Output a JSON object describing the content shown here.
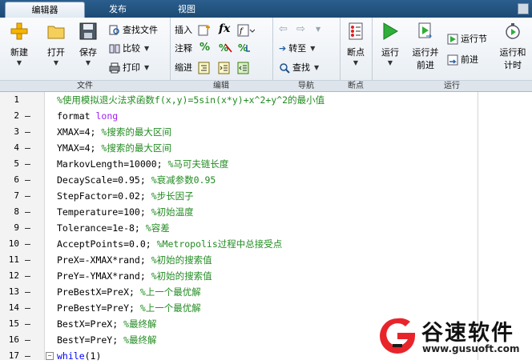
{
  "tabs": [
    {
      "label": "编辑器"
    },
    {
      "label": "发布"
    },
    {
      "label": "视图"
    }
  ],
  "toolstrip": {
    "file": {
      "group_label": "文件",
      "new_label": "新建",
      "open_label": "打开",
      "save_label": "保存",
      "find_files_label": "查找文件",
      "compare_label": "比较",
      "print_label": "打印"
    },
    "edit": {
      "group_label": "编辑",
      "insert_label": "插入",
      "comment_label": "注释",
      "indent_label": "缩进"
    },
    "navigate": {
      "group_label": "导航",
      "goto_label": "转至",
      "find_label": "查找"
    },
    "breakpoints": {
      "group_label": "断点",
      "breakpoints_label": "断点"
    },
    "run": {
      "group_label": "运行",
      "run_label": "运行",
      "run_advance_label_1": "运行并",
      "run_advance_label_2": "前进",
      "run_section_label": "运行节",
      "advance_label": "前进",
      "run_time_label_1": "运行和",
      "run_time_label_2": "计时"
    }
  },
  "editor": {
    "lines": [
      {
        "n": "1",
        "marker": "",
        "kw": "",
        "text": "",
        "comment": "%使用模拟退火法求函数f(x,y)=5sin(x*y)+x^2+y^2的最小值",
        "str": ""
      },
      {
        "n": "2",
        "marker": "—",
        "kw": "",
        "text": "format ",
        "comment": "",
        "str": "long"
      },
      {
        "n": "3",
        "marker": "—",
        "kw": "",
        "text": "XMAX=4; ",
        "comment": "%搜索的最大区间",
        "str": ""
      },
      {
        "n": "4",
        "marker": "—",
        "kw": "",
        "text": "YMAX=4; ",
        "comment": "%搜索的最大区间",
        "str": ""
      },
      {
        "n": "5",
        "marker": "—",
        "kw": "",
        "text": "MarkovLength=10000; ",
        "comment": "%马可夫链长度",
        "str": ""
      },
      {
        "n": "6",
        "marker": "—",
        "kw": "",
        "text": "DecayScale=0.95; ",
        "comment": "%衰减参数0.95",
        "str": ""
      },
      {
        "n": "7",
        "marker": "—",
        "kw": "",
        "text": "StepFactor=0.02; ",
        "comment": "%步长因子",
        "str": ""
      },
      {
        "n": "8",
        "marker": "—",
        "kw": "",
        "text": "Temperature=100; ",
        "comment": "%初始温度",
        "str": ""
      },
      {
        "n": "9",
        "marker": "—",
        "kw": "",
        "text": "Tolerance=1e-8; ",
        "comment": "%容差",
        "str": ""
      },
      {
        "n": "10",
        "marker": "—",
        "kw": "",
        "text": "AcceptPoints=0.0; ",
        "comment": "%Metropolis过程中总接受点",
        "str": ""
      },
      {
        "n": "11",
        "marker": "—",
        "kw": "",
        "text": "PreX=-XMAX*rand; ",
        "comment": "%初始的搜索值",
        "str": ""
      },
      {
        "n": "12",
        "marker": "—",
        "kw": "",
        "text": "PreY=-YMAX*rand; ",
        "comment": "%初始的搜索值",
        "str": ""
      },
      {
        "n": "13",
        "marker": "—",
        "kw": "",
        "text": "PreBestX=PreX; ",
        "comment": "%上一个最优解",
        "str": ""
      },
      {
        "n": "14",
        "marker": "—",
        "kw": "",
        "text": "PreBestY=PreY; ",
        "comment": "%上一个最优解",
        "str": ""
      },
      {
        "n": "15",
        "marker": "—",
        "kw": "",
        "text": "BestX=PreX; ",
        "comment": "%最终解",
        "str": ""
      },
      {
        "n": "16",
        "marker": "—",
        "kw": "",
        "text": "BestY=PreY; ",
        "comment": "%最终解",
        "str": ""
      },
      {
        "n": "17",
        "marker": "—",
        "kw": "while",
        "text": "(1)",
        "comment": "",
        "str": ""
      }
    ]
  },
  "watermark": {
    "brand": "谷速软件",
    "url": "www.gusuoft.com"
  },
  "colors": {
    "keyword": "#0000ff",
    "string": "#a020f0",
    "comment": "#228b22",
    "tab_bar": "#1c4a74",
    "watermark_red": "#e8242a"
  }
}
